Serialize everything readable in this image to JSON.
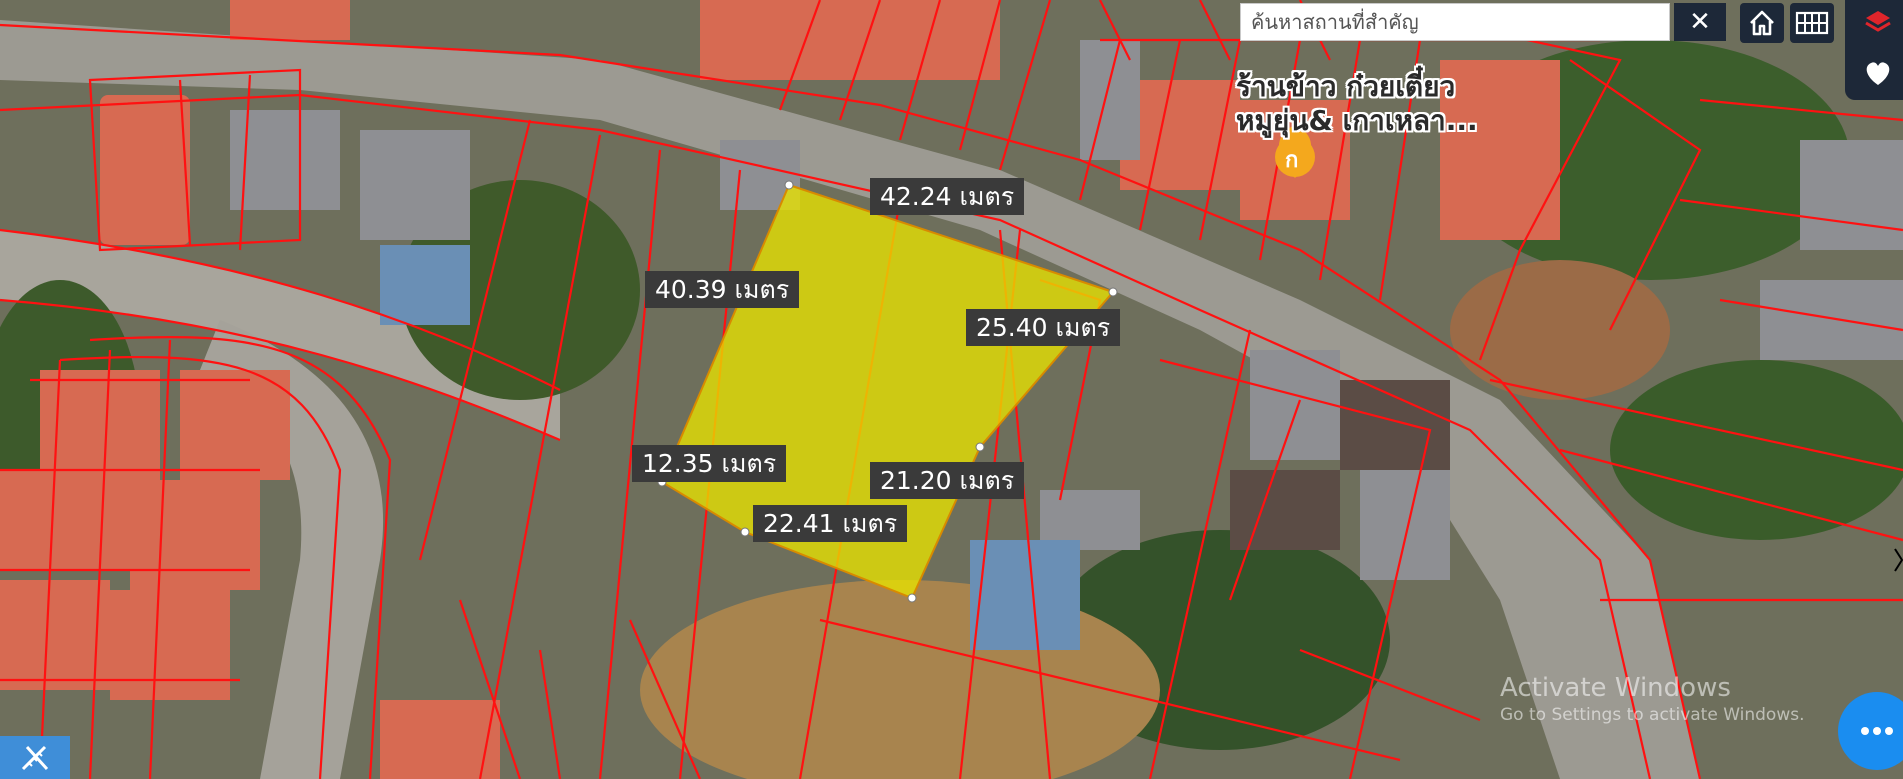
{
  "search": {
    "placeholder": "ค้นหาสถานที่สำคัญ",
    "value": "",
    "clear_label": "✕"
  },
  "toolbar": {
    "home_icon": "home-icon",
    "grid_icon": "grid-icon"
  },
  "side_panel": {
    "layers_icon": "layers-icon",
    "favorite_icon": "heart-icon"
  },
  "measurements": {
    "north_edge": "42.24 เมตร",
    "west_edge": "40.39 เมตร",
    "east_edge": "25.40 เมตร",
    "southwest_edge": "12.35 เมตร",
    "inner_edge": "21.20 เมตร",
    "south_edge": "22.41 เมตร"
  },
  "poi": {
    "line1": "ร้านข้าว ก๋วยเตี๋ยว",
    "line2": "หมูยุ่น& เกาเหลา...",
    "marker_label": "ก",
    "marker_color": "#f4a81d"
  },
  "parcel": {
    "fill_color": "#e8e300",
    "border_color": "#d88a00"
  },
  "overlay_color": "#ff1111",
  "watermark": {
    "line1": "Activate Windows",
    "line2": "Go to Settings to activate Windows."
  },
  "chat_icon": "chat-icon",
  "measure_tool_icon": "ruler-icon"
}
